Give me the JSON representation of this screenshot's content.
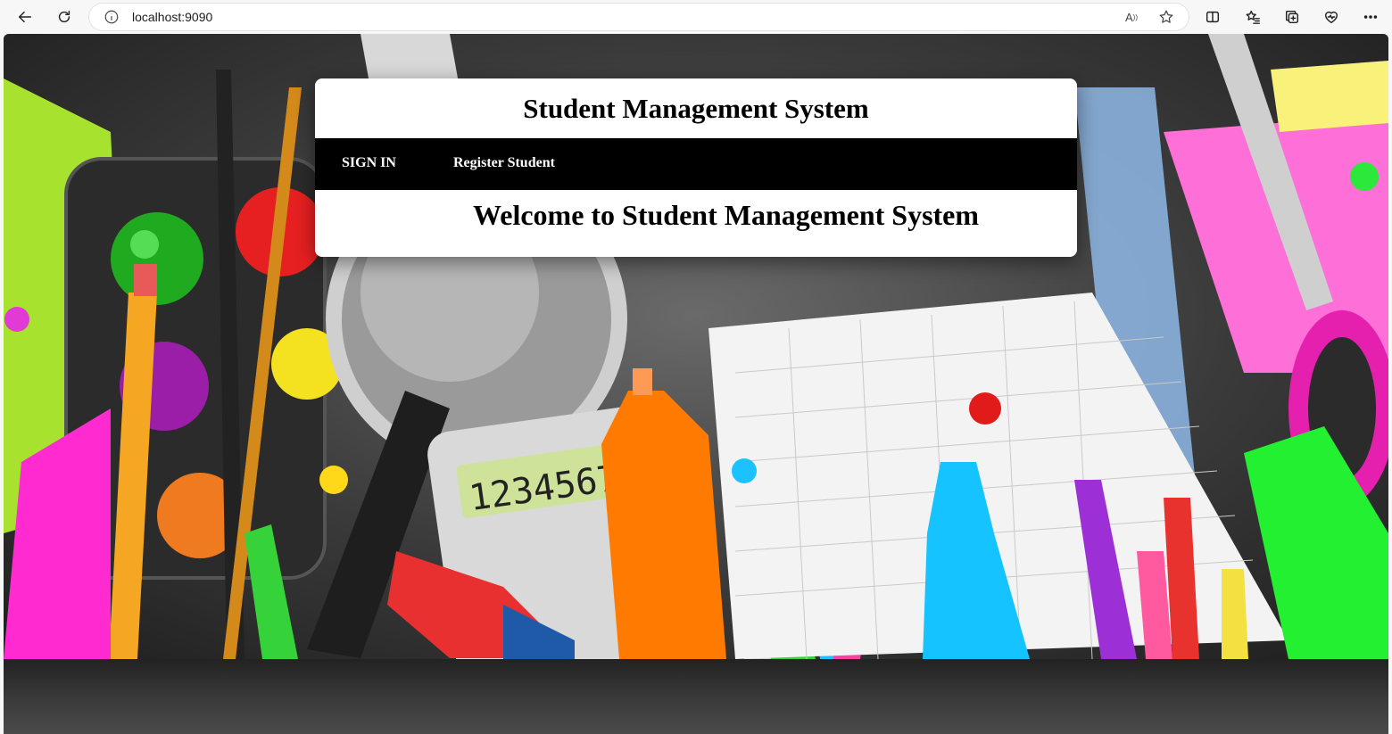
{
  "browser": {
    "url": "localhost:9090",
    "read_aloud_label": "A"
  },
  "page": {
    "title": "Student Management System",
    "nav": [
      {
        "label": "SIGN IN"
      },
      {
        "label": "Register Student"
      }
    ],
    "welcome": "Welcome to Student Management System"
  },
  "hero": {
    "calculator_display": "123456789"
  },
  "colors": {
    "navbar_bg": "#000000",
    "card_bg": "#ffffff",
    "hero_bg": "#3a3a3a"
  }
}
